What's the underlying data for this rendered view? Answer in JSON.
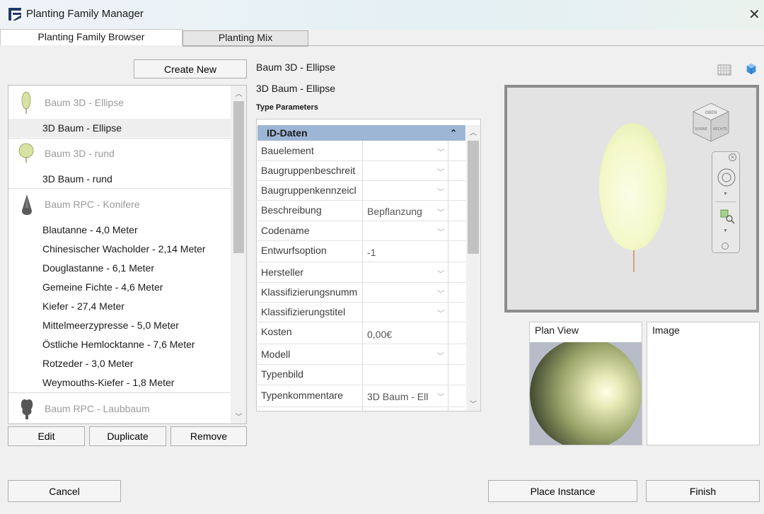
{
  "window": {
    "title": "Planting Family Manager",
    "close_glyph": "✕"
  },
  "tabs": [
    {
      "label": "Planting Family Browser",
      "active": true
    },
    {
      "label": "Planting Mix",
      "active": false
    }
  ],
  "left_panel": {
    "create_new_label": "Create New",
    "families": {
      "group1": "Baum 3D - Ellipse",
      "item1": "3D Baum - Ellipse",
      "group2": "Baum 3D - rund",
      "item2": "3D Baum - rund",
      "group3": "Baum RPC - Konifere",
      "items3": [
        "Blautanne - 4,0 Meter",
        "Chinesischer Wacholder - 2,14 Meter",
        "Douglastanne - 6,1 Meter",
        "Gemeine Fichte - 4,6 Meter",
        "Kiefer - 27,4 Meter",
        "Mittelmeerzypresse - 5,0 Meter",
        "Östliche Hemlocktanne - 7,6 Meter",
        "Rotzeder - 3,0 Meter",
        "Weymouths-Kiefer - 1,8 Meter"
      ],
      "group4": "Baum RPC - Laubbaum"
    },
    "edit_label": "Edit",
    "duplicate_label": "Duplicate",
    "remove_label": "Remove"
  },
  "details": {
    "family_name": "Baum 3D - Ellipse",
    "type_name": "3D Baum - Ellipse",
    "type_params_label": "Type Parameters",
    "group_header": "ID-Daten",
    "collapse_glyph": "⌃",
    "rows": [
      {
        "name": "Bauelement",
        "value": ""
      },
      {
        "name": "Baugruppenbeschreit",
        "value": ""
      },
      {
        "name": "Baugruppenkennzeicl",
        "value": ""
      },
      {
        "name": "Beschreibung",
        "value": "Bepflanzung"
      },
      {
        "name": "Codename",
        "value": ""
      },
      {
        "name": "Entwurfsoption",
        "value": "-1"
      },
      {
        "name": "Hersteller",
        "value": ""
      },
      {
        "name": "Klassifizierungsnumm",
        "value": ""
      },
      {
        "name": "Klassifizierungstitel",
        "value": ""
      },
      {
        "name": "Kosten",
        "value": "0,00€"
      },
      {
        "name": "Modell",
        "value": ""
      },
      {
        "name": "Typenbild",
        "value": ""
      },
      {
        "name": "Typenkommentare",
        "value": "3D Baum - Ell"
      }
    ]
  },
  "preview": {
    "plan_view_label": "Plan View",
    "image_label": "Image",
    "viewcube": {
      "top": "OBEN",
      "left": "VORNE",
      "right": "RECHTS"
    }
  },
  "footer": {
    "cancel_label": "Cancel",
    "place_instance_label": "Place Instance",
    "finish_label": "Finish"
  },
  "colors": {
    "grid_header": "#9eb6d5",
    "tree_foliage": "#f3f8c8",
    "viewport_bg": "#e3e3e3"
  }
}
